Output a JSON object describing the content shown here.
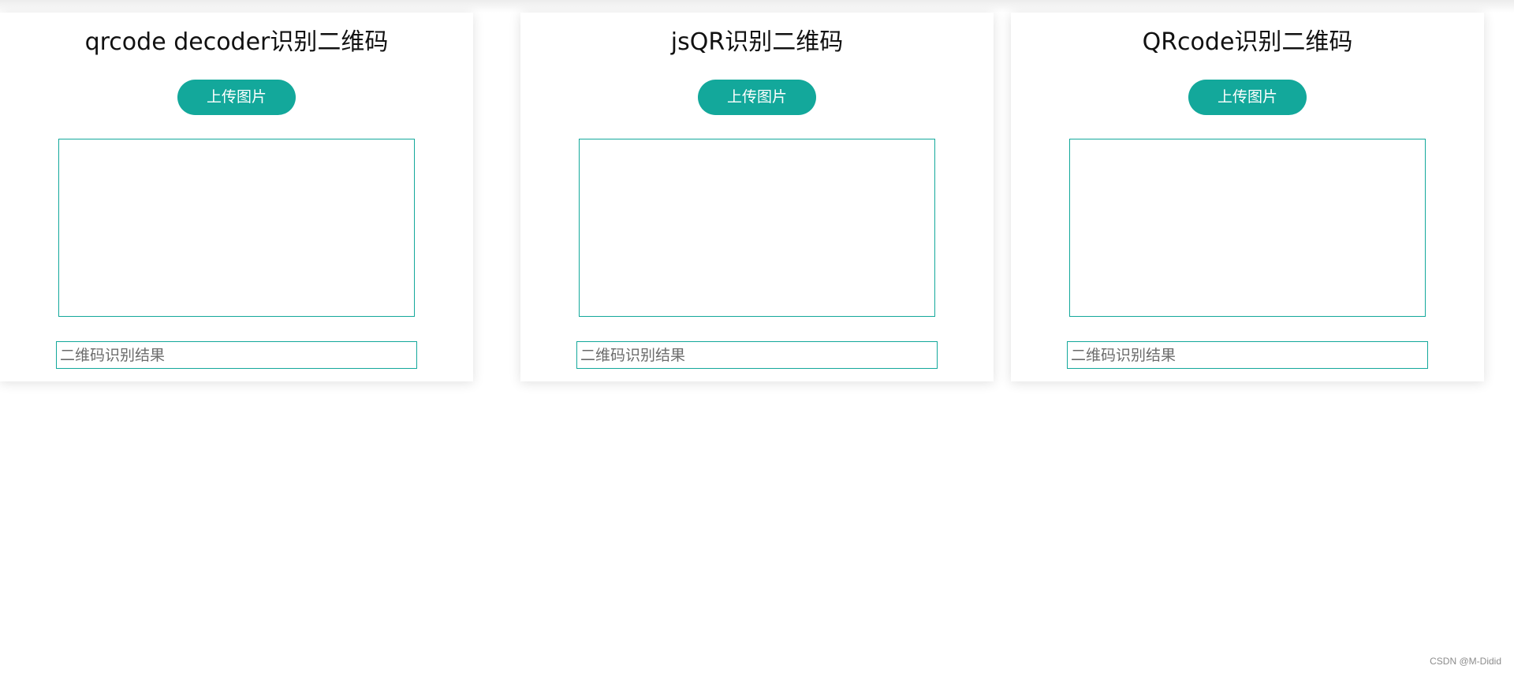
{
  "cards": [
    {
      "title": "jsQR识别二维码",
      "upload_label": "上传图片",
      "result_placeholder": "二维码识别结果"
    },
    {
      "title": "QRcode识别二维码",
      "upload_label": "上传图片",
      "result_placeholder": "二维码识别结果"
    },
    {
      "title": "qrcode decoder识别二维码",
      "upload_label": "上传图片",
      "result_placeholder": "二维码识别结果"
    }
  ],
  "watermark": "CSDN @M-Didid",
  "colors": {
    "accent": "#13a89b",
    "background": "#ffffff"
  }
}
